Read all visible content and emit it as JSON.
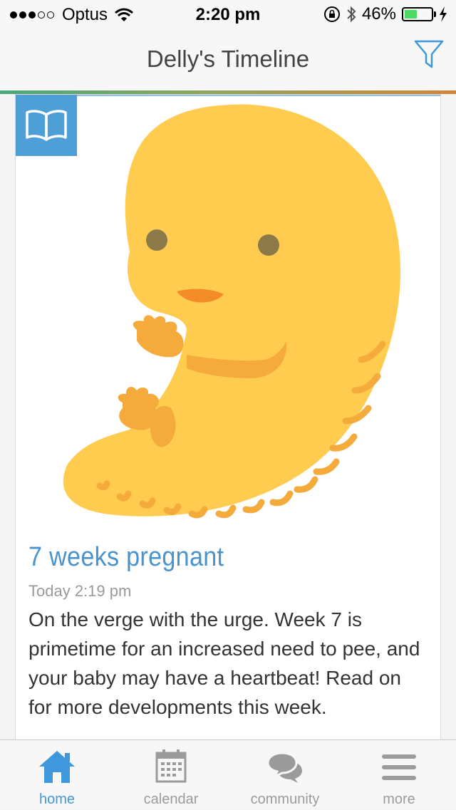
{
  "status_bar": {
    "carrier": "Optus",
    "signal_bars_filled": 3,
    "signal_bars_total": 5,
    "time": "2:20 pm",
    "battery_percent": "46%",
    "battery_level": 0.46
  },
  "nav": {
    "title": "Delly's Timeline",
    "filter_icon": "filter-funnel-icon"
  },
  "card": {
    "badge_icon": "open-book-icon",
    "illustration": "embryo-illustration",
    "title": "7 weeks pregnant",
    "timestamp": "Today 2:19 pm",
    "body": "On the verge with the urge. Week 7 is primetime for an increased need to pee, and your baby may have a heartbeat! Read on for more developments this week."
  },
  "tabs": [
    {
      "label": "home",
      "icon": "home-icon",
      "active": true
    },
    {
      "label": "calendar",
      "icon": "calendar-icon",
      "active": false
    },
    {
      "label": "community",
      "icon": "chat-bubbles-icon",
      "active": false
    },
    {
      "label": "more",
      "icon": "hamburger-menu-icon",
      "active": false
    }
  ],
  "colors": {
    "accent_blue": "#3f98dc",
    "badge_blue": "#4e9fd8",
    "embryo_yellow": "#ffcc4f",
    "embryo_orange": "#f5ab3c",
    "battery_green": "#4cd964"
  }
}
